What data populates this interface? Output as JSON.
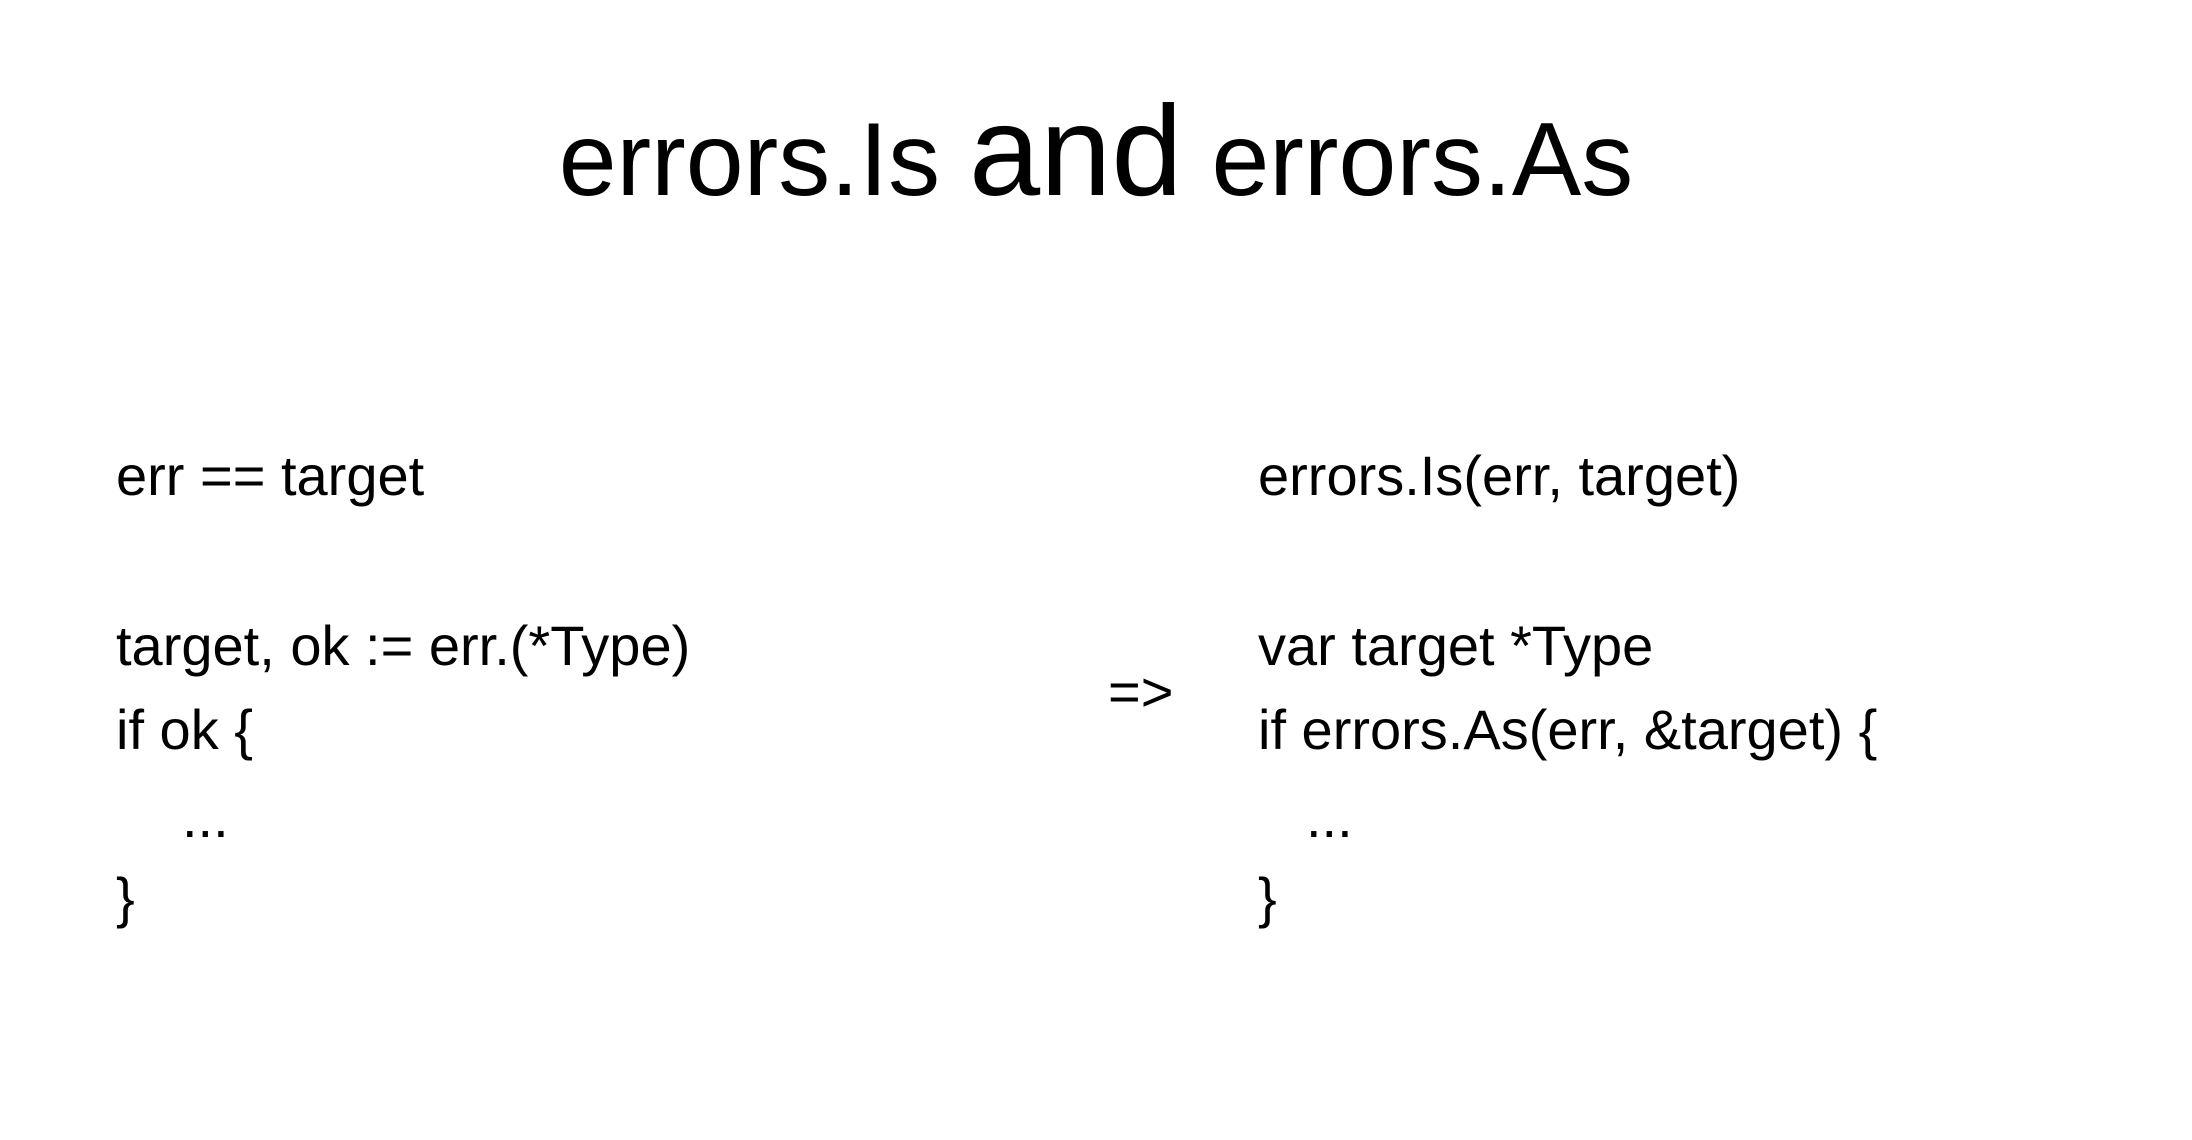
{
  "slide": {
    "title": {
      "part1": "errors.Is",
      "connector": "and",
      "part2": "errors.As"
    },
    "left_column": {
      "line1": "err == target",
      "line2": "target, ok := err.(*Type)",
      "line3": "if ok {",
      "line4": "...",
      "line5": "}"
    },
    "arrow": "=>",
    "right_column": {
      "line1": "errors.Is(err, target)",
      "line2": "var target *Type",
      "line3": "if errors.As(err, &target) {",
      "line4": "...",
      "line5": "}"
    }
  }
}
